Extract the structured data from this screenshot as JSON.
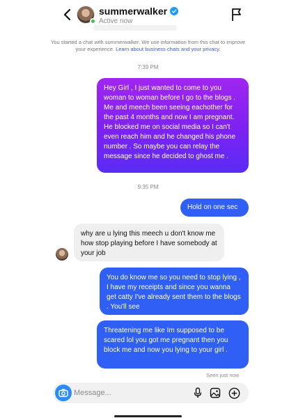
{
  "header": {
    "username": "summerwalker",
    "status": "Active now",
    "back_icon": "chevron-left-icon",
    "flag_icon": "flag-icon",
    "verified_icon": "verified-badge-icon"
  },
  "notice": {
    "text": "You started a chat with summerwalker. We use information from this chat to improve your experience.",
    "link": "Learn about business chats and your privacy."
  },
  "messages": {
    "time1": "7:39 PM",
    "m1": "Hey Girl , I just wanted to come to you woman to woman before I go to the blogs . Me and meech been seeing eachother for the past 4 months and now I am pregnant. He blocked me on social media so I can't even reach him and he changed his phone number . So maybe you can relay the message since he decided to ghost me .",
    "time2": "9:35 PM",
    "m2": "Hold on one sec",
    "m3": "why are u lying this meech u don't know me how stop playing before I have somebody at your job",
    "m4": "You do know me so you need to stop lying , I have my receipts and since you wanna get catty I've already sent them to the blogs . You'll see",
    "m5": "Threatening me like Im supposed to be scared lol you got me pregnant then you block me and now you lying to your girl .",
    "seen": "Seen just now"
  },
  "composer": {
    "placeholder": "Message...",
    "icons": [
      "camera-icon",
      "microphone-icon",
      "gallery-icon",
      "add-icon"
    ]
  },
  "colors": {
    "purple_top": "#a126f1",
    "purple_bottom": "#5b2cf6",
    "blue": "#2f5ff5",
    "received": "#efefef",
    "camera": "#2b8cf4",
    "online": "#2fc84a",
    "link": "#3b5ad6"
  }
}
